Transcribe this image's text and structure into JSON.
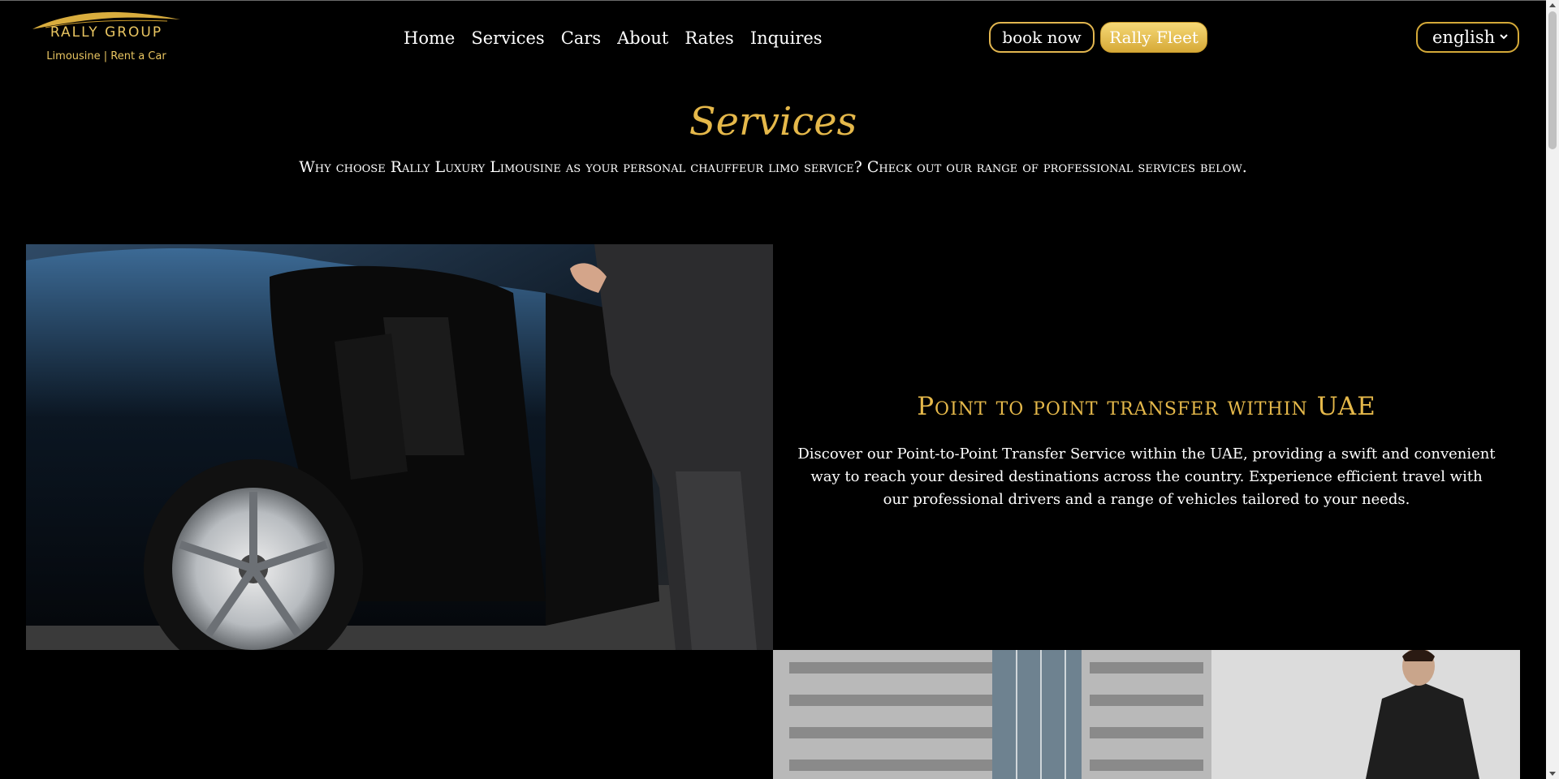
{
  "header": {
    "logo": {
      "brand": "RALLY GROUP",
      "tagline": "Limousine | Rent a Car"
    },
    "nav": [
      {
        "label": "Home"
      },
      {
        "label": "Services"
      },
      {
        "label": "Cars"
      },
      {
        "label": "About"
      },
      {
        "label": "Rates"
      },
      {
        "label": "Inquires"
      }
    ],
    "book_label": "book now",
    "fleet_label": "Rally Fleet",
    "language": {
      "selected": "english"
    }
  },
  "page": {
    "title": "Services",
    "subtitle": "Why choose Rally Luxury Limousine as your personal chauffeur limo service? Check out our range of professional services below."
  },
  "services": [
    {
      "heading": "Point to point transfer within UAE",
      "text": "Discover our Point-to-Point Transfer Service within the UAE, providing a swift and convenient way to reach your desired destinations across the country. Experience efficient travel with our professional drivers and a range of vehicles tailored to your needs.",
      "image": "chauffeur-opening-car-door"
    },
    {
      "image": "chauffeur-in-front-of-building"
    }
  ],
  "colors": {
    "gold": "#e5b84a",
    "background": "#000000",
    "fleet_button": "#e7c252"
  }
}
